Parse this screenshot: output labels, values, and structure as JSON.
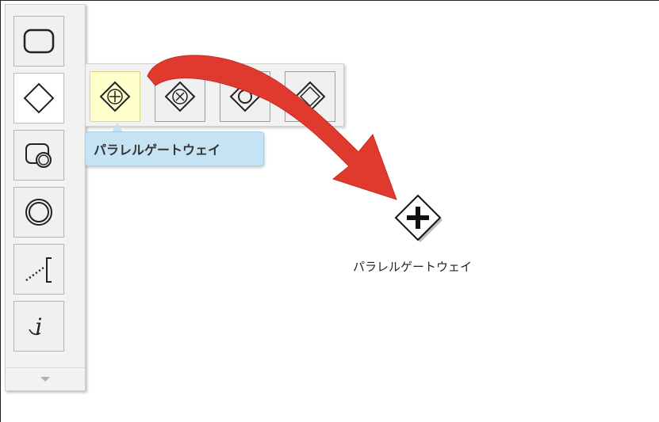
{
  "flyout": {
    "tooltip": "パラレルゲートウェイ"
  },
  "diagram": {
    "gateway_label": "パラレルゲートウェイ"
  },
  "palette": {
    "items": [
      {
        "name": "task-icon"
      },
      {
        "name": "gateway-icon",
        "active": true
      },
      {
        "name": "subprocess-icon"
      },
      {
        "name": "event-icon"
      },
      {
        "name": "association-icon"
      },
      {
        "name": "annotation-icon"
      }
    ],
    "scroll_icon": "chevron-down-icon"
  },
  "flyout_items": [
    {
      "name": "parallel-gateway-icon",
      "state": "hover"
    },
    {
      "name": "exclusive-gateway-icon"
    },
    {
      "name": "inclusive-gateway-icon"
    },
    {
      "name": "complex-gateway-icon"
    }
  ],
  "colors": {
    "arrow": "#e03a2f",
    "tooltip_bg": "#c6e3f3",
    "hover_bg": "#ffffcc"
  }
}
